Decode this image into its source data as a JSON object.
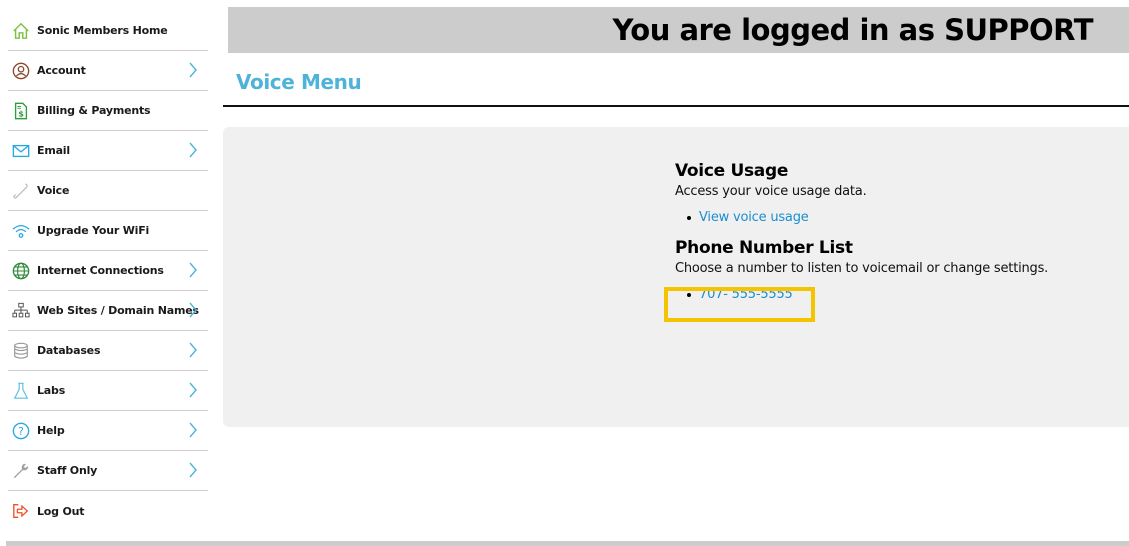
{
  "sidebar": {
    "items": [
      {
        "label": "Sonic Members Home",
        "icon": "home-icon",
        "has_chevron": false
      },
      {
        "label": "Account",
        "icon": "user-circle-icon",
        "has_chevron": true
      },
      {
        "label": "Billing & Payments",
        "icon": "billing-document-icon",
        "has_chevron": false
      },
      {
        "label": "Email",
        "icon": "envelope-icon",
        "has_chevron": true
      },
      {
        "label": "Voice",
        "icon": "phone-icon",
        "has_chevron": false
      },
      {
        "label": "Upgrade Your WiFi",
        "icon": "wifi-icon",
        "has_chevron": false
      },
      {
        "label": "Internet Connections",
        "icon": "globe-icon",
        "has_chevron": true
      },
      {
        "label": "Web Sites / Domain Names",
        "icon": "sitemap-icon",
        "has_chevron": true
      },
      {
        "label": "Databases",
        "icon": "database-icon",
        "has_chevron": true
      },
      {
        "label": "Labs",
        "icon": "flask-icon",
        "has_chevron": true
      },
      {
        "label": "Help",
        "icon": "help-circle-icon",
        "has_chevron": true
      },
      {
        "label": "Staff Only",
        "icon": "wrench-icon",
        "has_chevron": true
      },
      {
        "label": "Log Out",
        "icon": "logout-icon",
        "has_chevron": false
      }
    ]
  },
  "header": {
    "logged_in_text": "You are logged in as SUPPORT"
  },
  "main": {
    "page_title": "Voice Menu",
    "sections": [
      {
        "heading": "Voice Usage",
        "description": "Access your voice usage data.",
        "links": [
          "View voice usage"
        ]
      },
      {
        "heading": "Phone Number List",
        "description": "Choose a number to listen to voicemail or change settings.",
        "links": [
          "707- 555-5555"
        ]
      }
    ]
  },
  "colors": {
    "accent": "#4fb3d9",
    "link": "#1b8ecf",
    "highlight": "#f5c400",
    "header_bar": "#cccccc",
    "panel": "#f0f0f0"
  }
}
